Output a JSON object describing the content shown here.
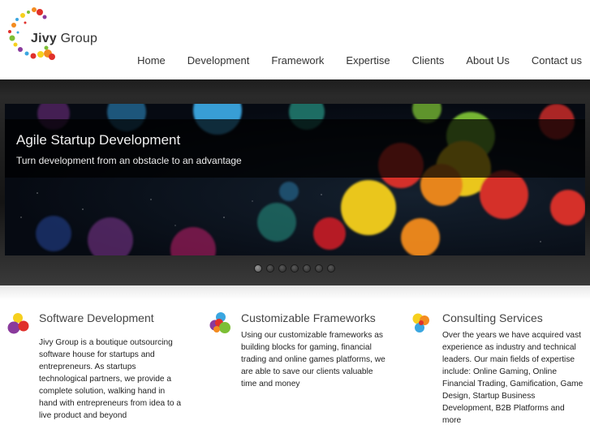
{
  "brand": {
    "name_bold": "Jivy",
    "name_rest": " Group"
  },
  "nav": {
    "items": [
      "Home",
      "Development",
      "Framework",
      "Expertise",
      "Clients",
      "About Us",
      "Contact us"
    ]
  },
  "slider": {
    "title": "Agile Startup Development",
    "subtitle": "Turn development from an obstacle to an advantage",
    "slide_count": 7,
    "active_slide": 1
  },
  "features": [
    {
      "title": "Software Development",
      "text": "Jivy Group is a boutique outsourcing software house for startups and entrepreneurs. As startups technological partners, we provide a complete solution, walking hand in hand with entrepreneurs from idea to a live product and beyond",
      "icon": "colorful-circles-icon"
    },
    {
      "title": "Customizable Frameworks",
      "text": "Using our customizable frameworks as building blocks for gaming, financial trading and online games platforms, we are able to save our clients valuable time and money",
      "icon": "colorful-circles-icon"
    },
    {
      "title": "Consulting Services",
      "text": "Over the years we have acquired vast experience as industry and technical leaders. Our main fields of expertise include: Online Gaming, Online Financial Trading, Gamification, Game Design, Startup Business Development, B2B Platforms and more",
      "icon": "colorful-circles-icon"
    }
  ],
  "colors": {
    "red": "#e0302b",
    "orange": "#f38b1f",
    "yellow": "#f6d01e",
    "green": "#7cbf36",
    "blue": "#3aa6e0",
    "purple": "#8a3a9c"
  }
}
